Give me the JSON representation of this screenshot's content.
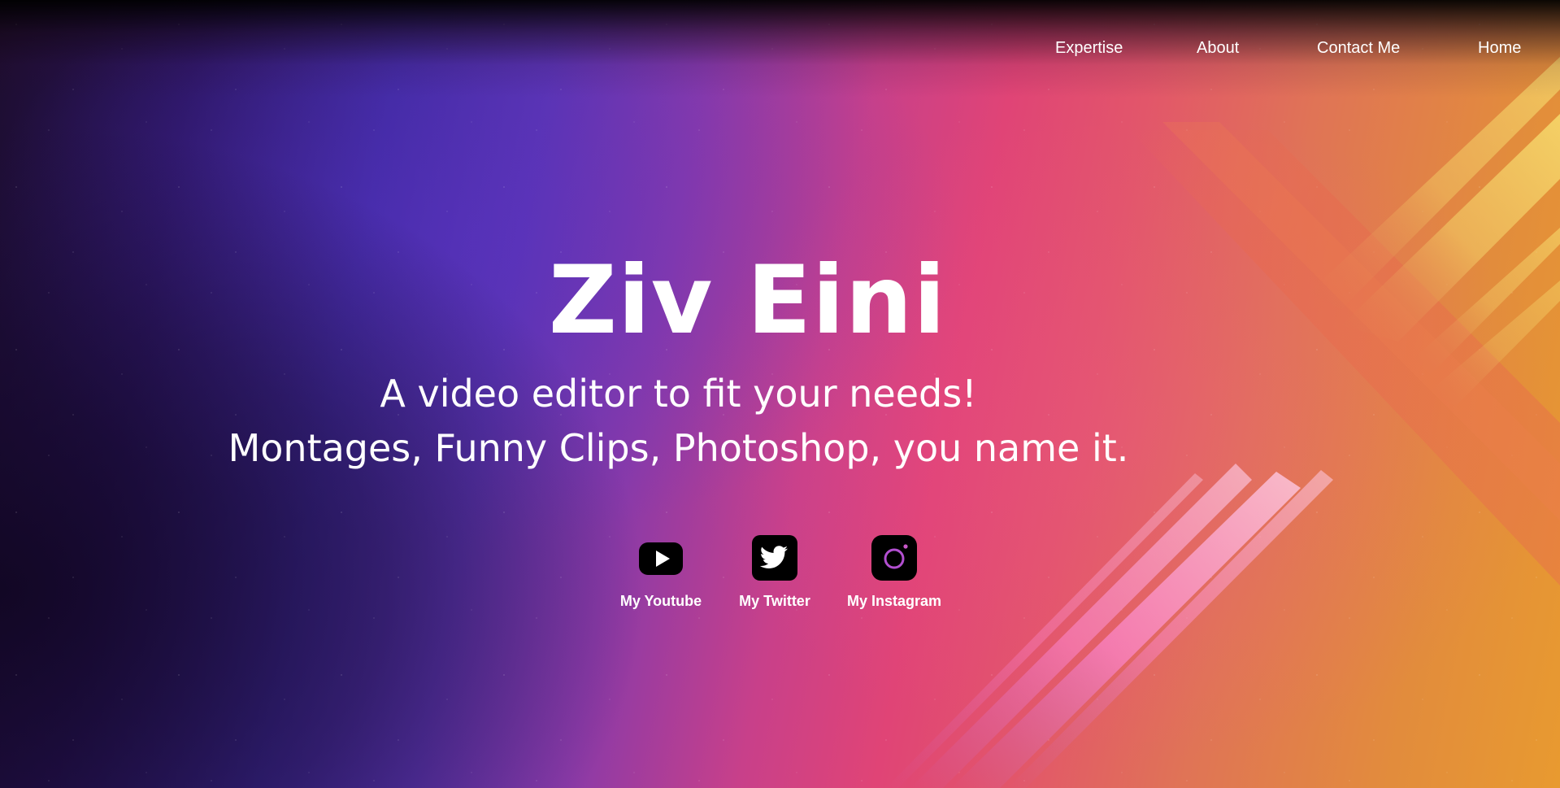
{
  "nav": {
    "items": [
      {
        "label": "Expertise"
      },
      {
        "label": "About"
      },
      {
        "label": "Contact Me"
      },
      {
        "label": "Home"
      }
    ]
  },
  "hero": {
    "title": "Ziv Eini",
    "tagline_line1": "A video editor to fit your needs!",
    "tagline_line2": "Montages, Funny Clips, Photoshop, you name it."
  },
  "social": {
    "youtube": {
      "label": "My Youtube",
      "icon": "youtube-icon"
    },
    "twitter": {
      "label": "My Twitter",
      "icon": "twitter-icon"
    },
    "instagram": {
      "label": "My Instagram",
      "icon": "instagram-icon"
    }
  },
  "colors": {
    "gradient_left": "#2a1560",
    "gradient_mid": "#e04476",
    "gradient_right": "#e89a30",
    "text": "#ffffff",
    "icon": "#000000"
  }
}
